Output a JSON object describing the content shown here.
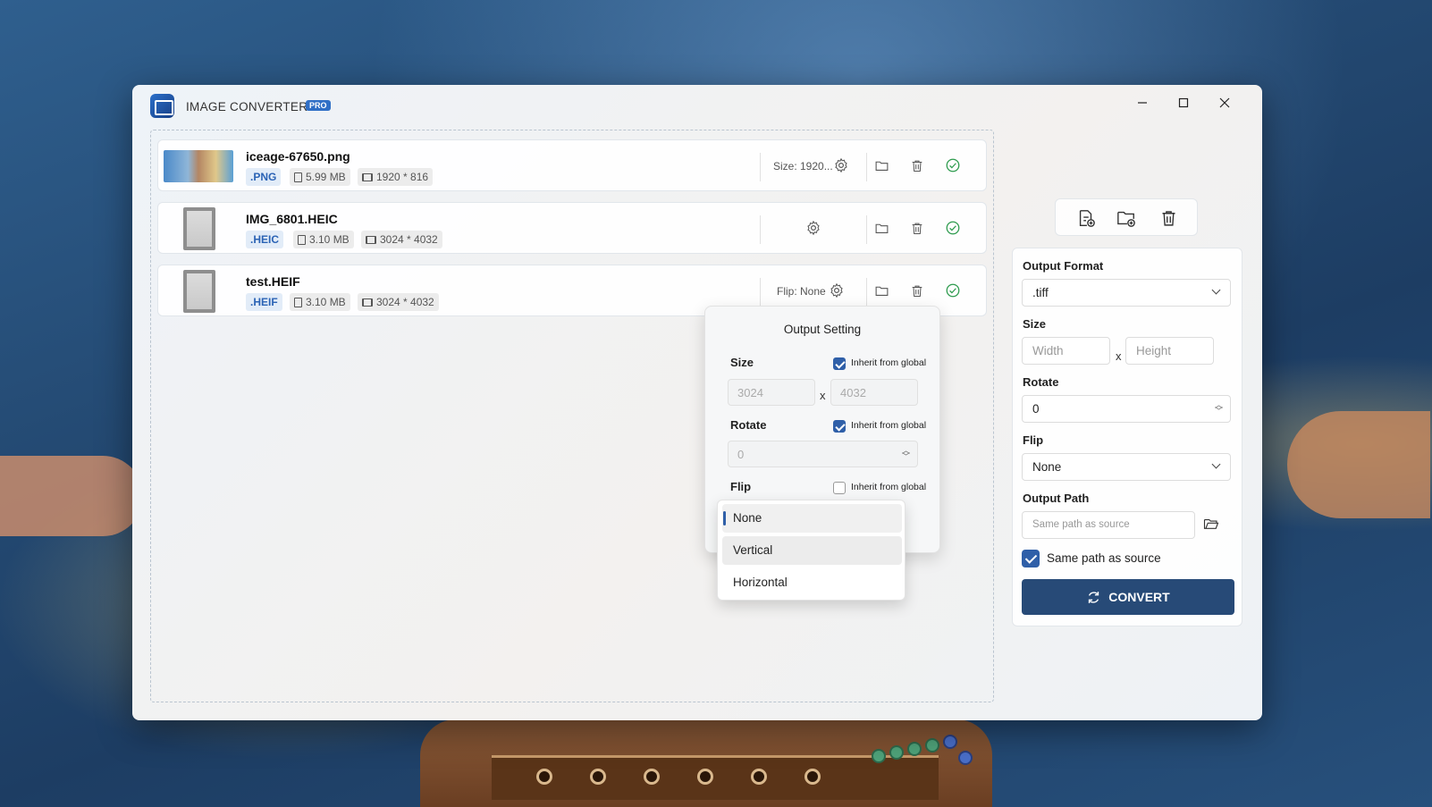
{
  "app": {
    "title": "IMAGE CONVERTER",
    "badge": "PRO"
  },
  "window_controls": {
    "minimize": "—",
    "maximize": "☐",
    "close": "✕"
  },
  "files": [
    {
      "name": "iceage-67650.png",
      "ext": ".PNG",
      "size": "5.99 MB",
      "dimensions": "1920 * 816",
      "status_text": "Size: 1920..."
    },
    {
      "name": "IMG_6801.HEIC",
      "ext": ".HEIC",
      "size": "3.10 MB",
      "dimensions": "3024 * 4032",
      "status_text": ""
    },
    {
      "name": "test.HEIF",
      "ext": ".HEIF",
      "size": "3.10 MB",
      "dimensions": "3024 * 4032",
      "status_text": "Flip: None"
    }
  ],
  "output_setting_popover": {
    "title": "Output Setting",
    "size_label": "Size",
    "rotate_label": "Rotate",
    "flip_label": "Flip",
    "inherit_label": "Inherit from global",
    "size_inherit": true,
    "rotate_inherit": true,
    "flip_inherit": false,
    "width_value": "3024",
    "height_value": "4032",
    "x_sep": "x",
    "rotate_value": "0",
    "flip_options": [
      "None",
      "Vertical",
      "Horizontal"
    ],
    "flip_selected": "None"
  },
  "global_settings": {
    "output_format_label": "Output Format",
    "output_format_value": ".tiff",
    "size_label": "Size",
    "width_placeholder": "Width",
    "height_placeholder": "Height",
    "x_sep": "x",
    "rotate_label": "Rotate",
    "rotate_value": "0",
    "flip_label": "Flip",
    "flip_value": "None",
    "output_path_label": "Output Path",
    "output_path_placeholder": "Same path as source",
    "same_path_label": "Same path as source",
    "same_path_checked": true,
    "convert_label": "CONVERT"
  },
  "colors": {
    "accent": "#2f5fa8",
    "convert_bg": "#274a77",
    "success": "#2e9b4e",
    "ext_tag_text": "#2b63b5"
  }
}
